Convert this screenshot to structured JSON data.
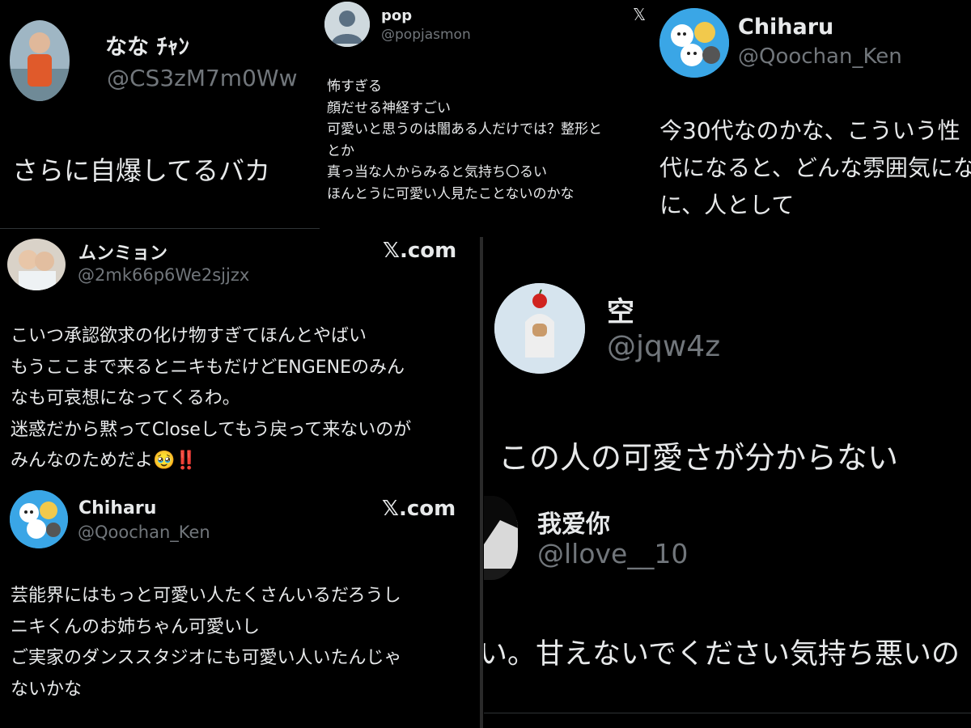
{
  "tweets": [
    {
      "name": "なな ﾁｬﾝ",
      "handle": "@CS3zM7m0Ww",
      "lines": [
        "さらに自爆してるバカ"
      ],
      "avatar_icon": "person-photo-icon"
    },
    {
      "name": "pop",
      "handle": "@popjasmon",
      "lines": [
        "怖すぎる",
        "顔だせる神経すごい",
        "可愛いと思うのは闇ある人だけでは？整形と",
        "とか",
        "真っ当な人からみると気持ち〇るい",
        "ほんとうに可愛い人見たことないのかな"
      ],
      "avatar_icon": "default-user-icon",
      "x_logo": "𝕏"
    },
    {
      "name": "Chiharu",
      "handle": "@Qoochan_Ken",
      "lines": [
        "今30代なのかな、こういう性",
        "代になると、どんな雰囲気にな",
        "に、人として"
      ],
      "avatar_icon": "cartoon-characters-icon"
    },
    {
      "name": "ムンミョン",
      "handle": "@2mk66p6We2sjjzx",
      "x_com": "𝕏.com",
      "lines": [
        "こいつ承認欲求の化け物すぎてほんとやばい",
        "もうここまで来るとニキもだけどENGENEのみん",
        "なも可哀想になってくるわ。",
        "迷惑だから黙ってCloseしてもう戻って来ないのが",
        "みんなのためだよ🥹‼️"
      ],
      "avatar_icon": "person-photo-icon"
    },
    {
      "name": "空",
      "handle": "@jqw4z",
      "lines": [
        "この人の可愛さが分からない"
      ],
      "avatar_icon": "apple-figure-icon"
    },
    {
      "name": "Chiharu",
      "handle": "@Qoochan_Ken",
      "x_com": "𝕏.com",
      "lines": [
        "芸能界にはもっと可愛い人たくさんいるだろうし",
        "ニキくんのお姉ちゃん可愛いし",
        "ご実家のダンススタジオにも可愛い人いたんじゃ",
        "ないかな"
      ],
      "avatar_icon": "cartoon-characters-icon"
    },
    {
      "name": "我爱你",
      "handle": "@llove__10",
      "lines": [
        "い。甘えないでください気持ち悪いの"
      ],
      "avatar_icon": "dark-hair-person-icon"
    }
  ],
  "colors": {
    "background": "#000000",
    "text": "#e7e9ea",
    "handle": "#71767b"
  }
}
